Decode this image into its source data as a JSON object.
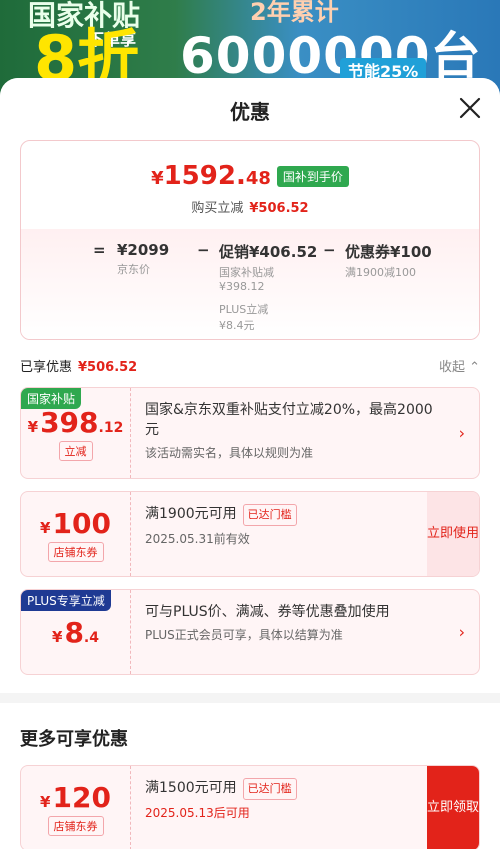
{
  "banner": {
    "line1": "国家补贴",
    "big8": "8折",
    "small": "下单享",
    "top_right": "2年累计",
    "number": "6000000台",
    "badge": "节能25%"
  },
  "sheet": {
    "title": "优惠"
  },
  "price_card": {
    "currency": "¥",
    "price_int": "1592.",
    "price_dec": "48",
    "tag": "国补到手价",
    "buy_label": "购买立减",
    "buy_amount": "¥506.52",
    "eq": "=",
    "base_price": "¥2099",
    "base_label": "京东价",
    "minus1": "−",
    "promo": "促销¥406.52",
    "promo_sub1": "国家补贴减",
    "promo_sub1_val": "¥398.12",
    "promo_sub2": "PLUS立减",
    "promo_sub2_val": "¥8.4元",
    "minus2": "−",
    "coupon": "优惠券¥100",
    "coupon_sub": "满1900减100"
  },
  "enjoyed": {
    "label": "已享优惠",
    "amount": "¥506.52",
    "collapse": "收起"
  },
  "coupons": [
    {
      "tag": "国家补贴",
      "cur": "¥",
      "int": "398",
      "dec": ".12",
      "box": "立减",
      "desc": "国家&京东双重补贴支付立减20%，最高2000元",
      "desc2": "该活动需实名，具体以规则为准",
      "arrow": "›"
    },
    {
      "cur": "¥",
      "int": "100",
      "box": "店铺东券",
      "desc": "满1900元可用",
      "reach": "已达门槛",
      "desc2": "2025.05.31前有效",
      "button": "立即使用"
    },
    {
      "tag": "PLUS专享立减",
      "cur": "¥",
      "int": "8",
      "dec": ".4",
      "desc": "可与PLUS价、满减、券等优惠叠加使用",
      "desc2": "PLUS正式会员可享，具体以结算为准",
      "arrow": "›"
    }
  ],
  "more": {
    "title": "更多可享优惠",
    "coupon": {
      "cur": "¥",
      "int": "120",
      "box": "店铺东券",
      "desc": "满1500元可用",
      "reach": "已达门槛",
      "desc2": "2025.05.13后可用",
      "button": "立即领取"
    }
  },
  "colors": {
    "accent": "#e2231a",
    "green": "#2fa84f",
    "plus_blue": "#1f3a93"
  }
}
